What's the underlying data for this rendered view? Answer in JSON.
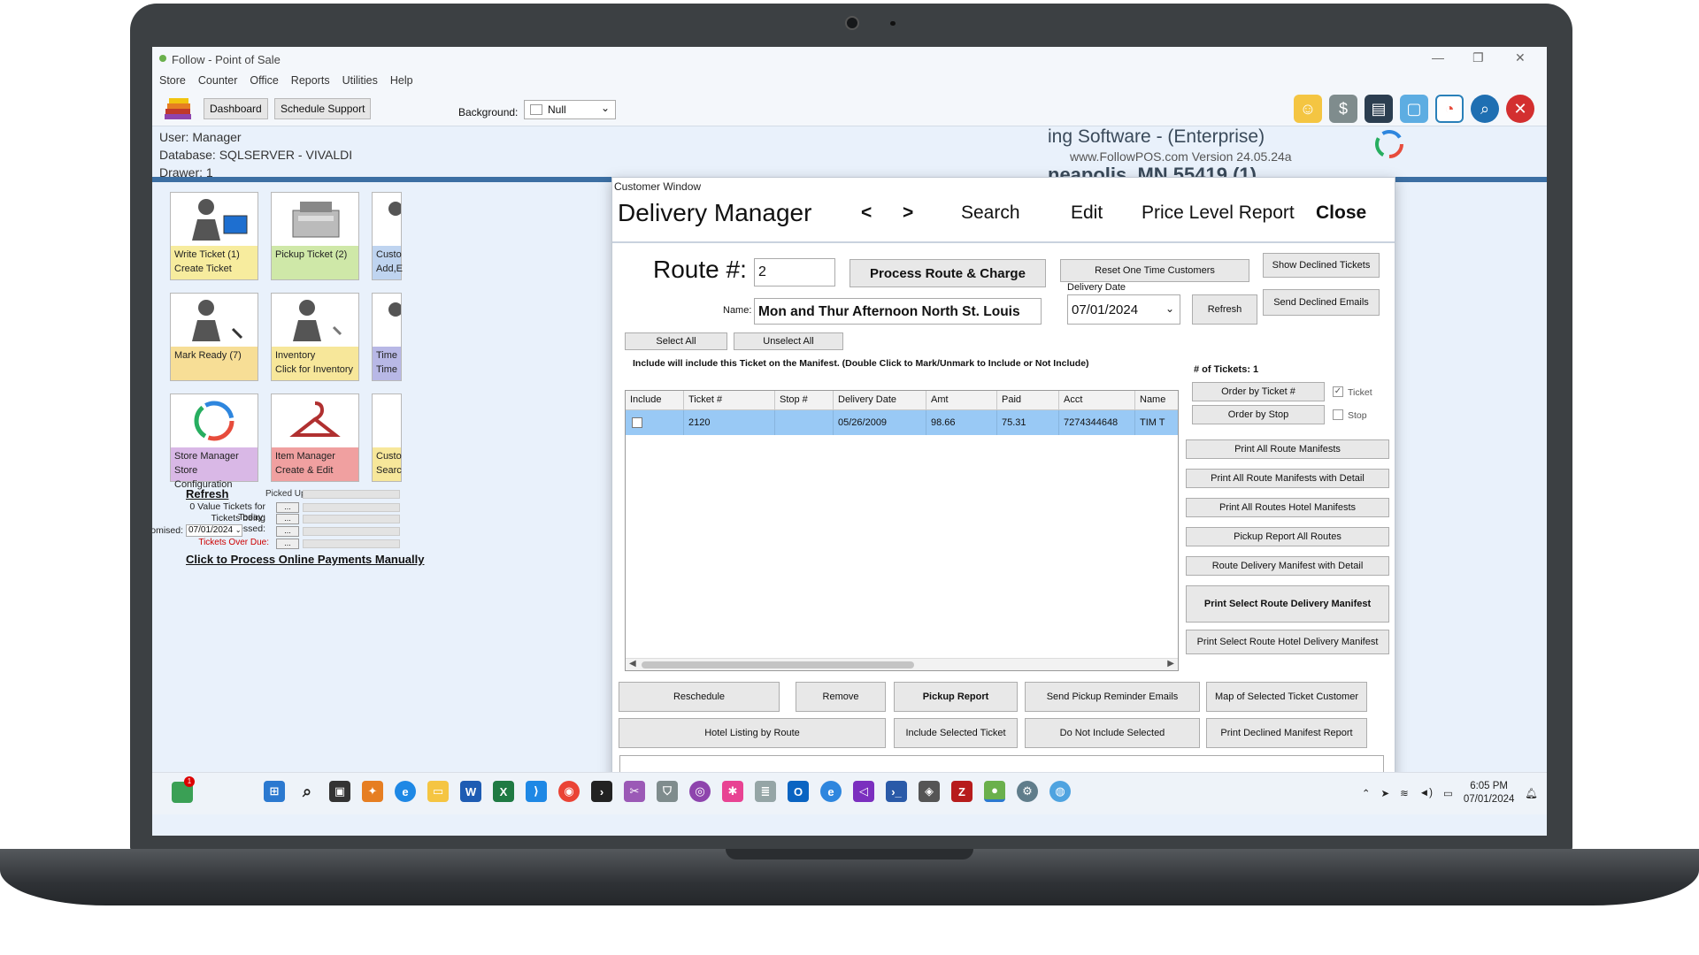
{
  "window": {
    "title": "Follow - Point of Sale",
    "minimize": "—",
    "restore": "❐",
    "close": "✕"
  },
  "menu": [
    "Store",
    "Counter",
    "Office",
    "Reports",
    "Utilities",
    "Help"
  ],
  "toolbar": {
    "dashboard": "Dashboard",
    "schedule_support": "Schedule Support",
    "background_label": "Background:",
    "background_value": "Null"
  },
  "info": {
    "user": "User: Manager",
    "database": "Database: SQLSERVER  - VIVALDI",
    "drawer": "Drawer: 1"
  },
  "company": {
    "name": "ing Software - (Enterprise)",
    "web": "www.FollowPOS.com Version 24.05.24a",
    "city": "neapolis, MN 55419 (1)"
  },
  "tiles": [
    {
      "line1": "Write Ticket  (1)",
      "line2": "Create Ticket",
      "color": "#f7ec9e"
    },
    {
      "line1": "Pickup Ticket (2)",
      "line2": "",
      "color": "#cfe8a8"
    },
    {
      "line1": "Custo",
      "line2": "Add,E",
      "color": "#bfd4f0"
    },
    {
      "line1": "Mark Ready (7)",
      "line2": "",
      "color": "#f7de96"
    },
    {
      "line1": "Inventory",
      "line2": "Click for Inventory",
      "color": "#f7e79a"
    },
    {
      "line1": "Time",
      "line2": "Time",
      "color": "#b8b8e6"
    },
    {
      "line1": "Store Manager",
      "line2": "Store Configuration",
      "color": "#d9b8e6"
    },
    {
      "line1": "Item Manager",
      "line2": "Create & Edit",
      "color": "#f0a0a0"
    },
    {
      "line1": "Custo",
      "line2": "Searc",
      "color": "#f7e79a"
    }
  ],
  "stats": {
    "refresh": "Refresh",
    "picked_up": "Picked Up:",
    "zero_value": "0 Value Tickets for Today:",
    "processing": "Tickets being Processed:",
    "promised": "Promised:",
    "promised_date": "07/01/2024",
    "overdue": "Tickets Over Due:",
    "dots": "...",
    "process_online": "Click to Process Online Payments Manually"
  },
  "dialog": {
    "window_label": "Customer Window",
    "nav": {
      "title": "Delivery Manager",
      "prev": "<",
      "next": ">",
      "search": "Search",
      "edit": "Edit",
      "price_level": "Price Level Report",
      "close": "Close"
    },
    "route_label": "Route #:",
    "route_value": "2",
    "process_route": "Process Route & Charge",
    "reset_customers": "Reset One Time Customers",
    "show_declined": "Show Declined Tickets",
    "send_declined": "Send Declined Emails",
    "delivery_date_label": "Delivery Date",
    "delivery_date": "07/01/2024",
    "refresh": "Refresh",
    "name_label": "Name:",
    "name_value": "Mon and Thur Afternoon North St. Louis",
    "select_all": "Select All",
    "unselect_all": "Unselect All",
    "instruction": "Include will include this Ticket on the Manifest. (Double Click to Mark/Unmark to Include or Not Include)",
    "ticket_count": "# of Tickets: 1",
    "order_ticket": "Order by Ticket #",
    "order_stop": "Order by Stop",
    "chk_ticket": "Ticket",
    "chk_stop": "Stop",
    "grid": {
      "columns": [
        "Include",
        "Ticket #",
        "Stop #",
        "Delivery Date",
        "Amt",
        "Paid",
        "Acct",
        "Name"
      ],
      "rows": [
        {
          "include": "",
          "ticket": "2120",
          "stop": "",
          "date": "05/26/2009",
          "amt": "98.66",
          "paid": "75.31",
          "acct": "7274344648",
          "name": "TIM T"
        }
      ]
    },
    "side_buttons": [
      "Print All Route Manifests",
      "Print All Route Manifests with Detail",
      "Print All Routes Hotel Manifests",
      "Pickup Report All Routes",
      "Route Delivery Manifest with Detail",
      "Print Select Route Delivery Manifest",
      "Print Select Route Hotel Delivery Manifest"
    ],
    "bottom_row1": [
      "Reschedule",
      "Remove",
      "Pickup Report",
      "Send Pickup Reminder Emails",
      "Map of Selected Ticket Customer"
    ],
    "bottom_row2": [
      "Hotel Listing by Route",
      "Include Selected Ticket",
      "Do Not Include Selected",
      "Print Declined Manifest Report"
    ]
  },
  "taskbar": {
    "time": "6:05 PM",
    "date": "07/01/2024",
    "badge": "1"
  }
}
